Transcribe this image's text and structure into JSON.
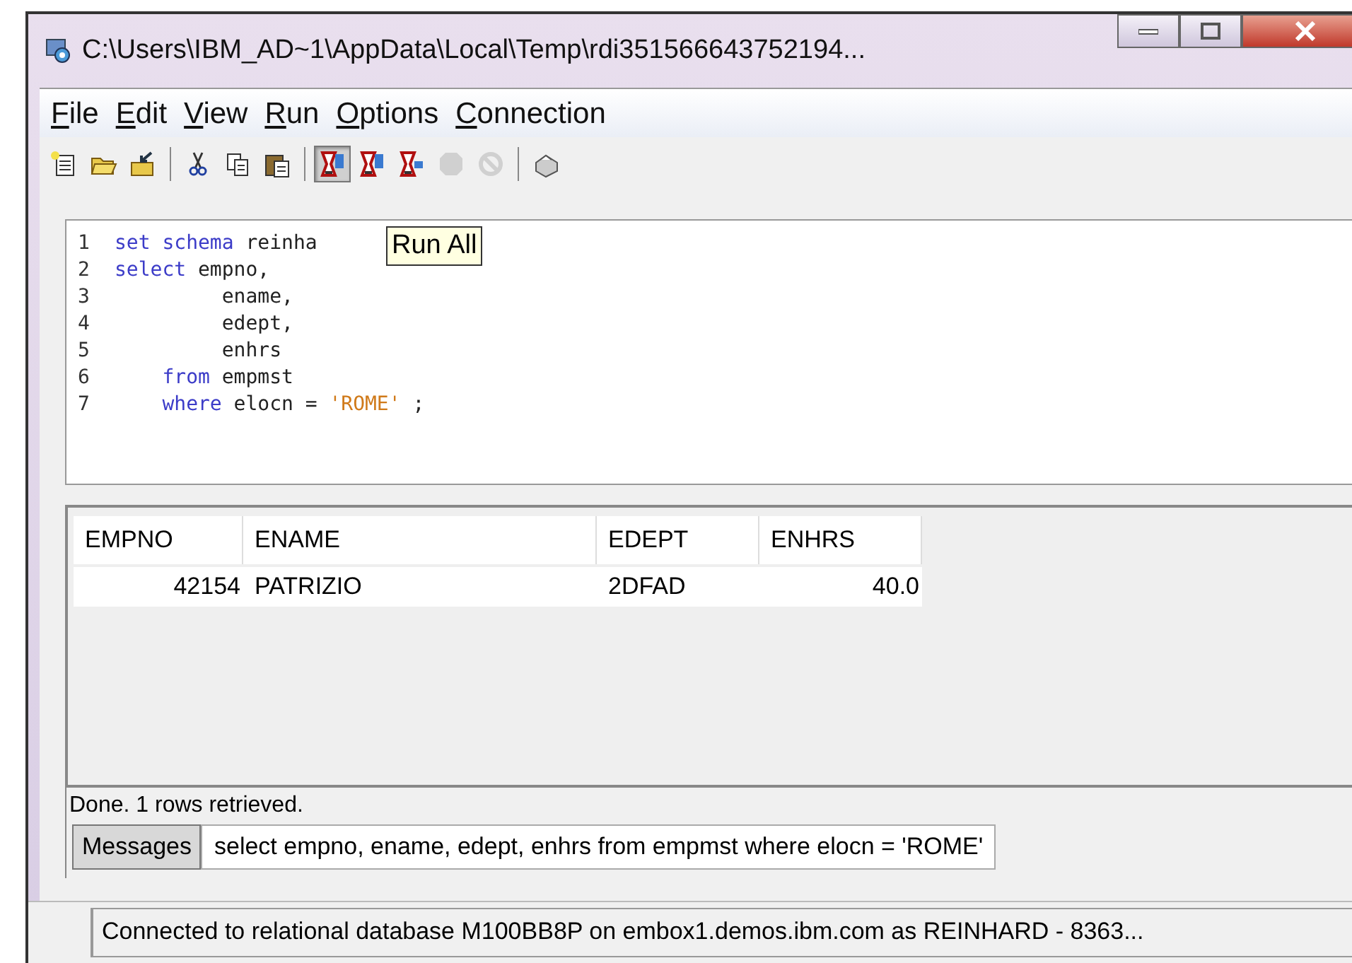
{
  "window": {
    "title": "C:\\Users\\IBM_AD~1\\AppData\\Local\\Temp\\rdi351566643752194..."
  },
  "menu": [
    "File",
    "Edit",
    "View",
    "Run",
    "Options",
    "Connection"
  ],
  "toolbar": [
    {
      "kind": "new",
      "pressed": false,
      "disabled": false
    },
    {
      "kind": "open",
      "pressed": false,
      "disabled": false
    },
    {
      "kind": "import",
      "pressed": false,
      "disabled": false
    },
    {
      "kind": "separator"
    },
    {
      "kind": "cut",
      "pressed": false,
      "disabled": false
    },
    {
      "kind": "copy",
      "pressed": false,
      "disabled": false
    },
    {
      "kind": "paste",
      "pressed": false,
      "disabled": false
    },
    {
      "kind": "separator"
    },
    {
      "kind": "run",
      "pressed": true,
      "disabled": false
    },
    {
      "kind": "run",
      "pressed": false,
      "disabled": false
    },
    {
      "kind": "run-single",
      "pressed": false,
      "disabled": false
    },
    {
      "kind": "stop",
      "pressed": false,
      "disabled": true
    },
    {
      "kind": "cancel",
      "pressed": false,
      "disabled": true
    },
    {
      "kind": "separator"
    },
    {
      "kind": "print",
      "pressed": false,
      "disabled": false
    }
  ],
  "tooltip": "Run All",
  "editor": {
    "lines": [
      {
        "number": "1",
        "tokens": [
          {
            "kind": "keyword",
            "text": "set schema"
          },
          {
            "kind": "plain",
            "text": " reinha"
          }
        ]
      },
      {
        "number": "2",
        "tokens": [
          {
            "kind": "keyword",
            "text": "select"
          },
          {
            "kind": "plain",
            "text": " empno,"
          }
        ]
      },
      {
        "number": "3",
        "tokens": [
          {
            "kind": "plain",
            "text": "         ename,"
          }
        ]
      },
      {
        "number": "4",
        "tokens": [
          {
            "kind": "plain",
            "text": "         edept,"
          }
        ]
      },
      {
        "number": "5",
        "tokens": [
          {
            "kind": "plain",
            "text": "         enhrs"
          }
        ]
      },
      {
        "number": "6",
        "tokens": [
          {
            "kind": "keyword",
            "text": "    from"
          },
          {
            "kind": "plain",
            "text": " empmst"
          }
        ]
      },
      {
        "number": "7",
        "tokens": [
          {
            "kind": "keyword",
            "text": "    where"
          },
          {
            "kind": "plain",
            "text": " elocn = "
          },
          {
            "kind": "string",
            "text": "'ROME'"
          },
          {
            "kind": "plain",
            "text": " ;"
          }
        ]
      }
    ]
  },
  "table": {
    "columns": [
      "EMPNO",
      "ENAME",
      "EDEPT",
      "ENHRS"
    ],
    "rows": [
      [
        "42154",
        "PATRIZIO",
        "2DFAD",
        "40.0"
      ]
    ]
  },
  "result_status": "Done. 1 rows retrieved.",
  "messages_tab": {
    "label": "Messages",
    "selected": true
  },
  "message_text": "select empno, ename, edept, enhrs from empmst where elocn = 'ROME'",
  "status_bar": "Connected to relational database M100BB8P on embox1.demos.ibm.com as REINHARD - 8363..."
}
